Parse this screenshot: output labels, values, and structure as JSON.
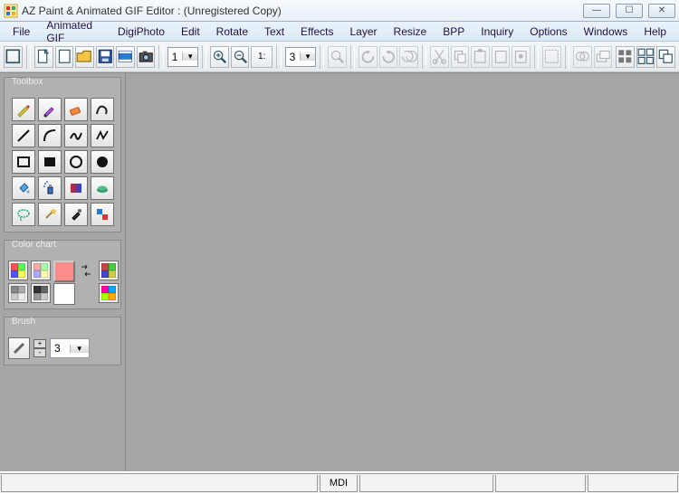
{
  "window": {
    "title": "AZ Paint & Animated GIF Editor : (Unregistered Copy)",
    "min": "—",
    "max": "☐",
    "close": "✕"
  },
  "menu": {
    "file": "File",
    "animated_gif": "Animated GIF",
    "digiphoto": "DigiPhoto",
    "edit": "Edit",
    "rotate": "Rotate",
    "text": "Text",
    "effects": "Effects",
    "layer": "Layer",
    "resize": "Resize",
    "bpp": "BPP",
    "inquiry": "Inquiry",
    "options": "Options",
    "windows": "Windows",
    "help": "Help"
  },
  "toolbar": {
    "zoom1_value": "1",
    "zoom2_value": "3",
    "ratio_label": "1:"
  },
  "panels": {
    "toolbox": {
      "legend": "Toolbox"
    },
    "color_chart": {
      "legend": "Color chart",
      "current_color": "#ff8b8b",
      "secondary_color": "#ffffff"
    },
    "brush": {
      "legend": "Brush",
      "size": "3"
    }
  },
  "status": {
    "mode": "MDI"
  }
}
